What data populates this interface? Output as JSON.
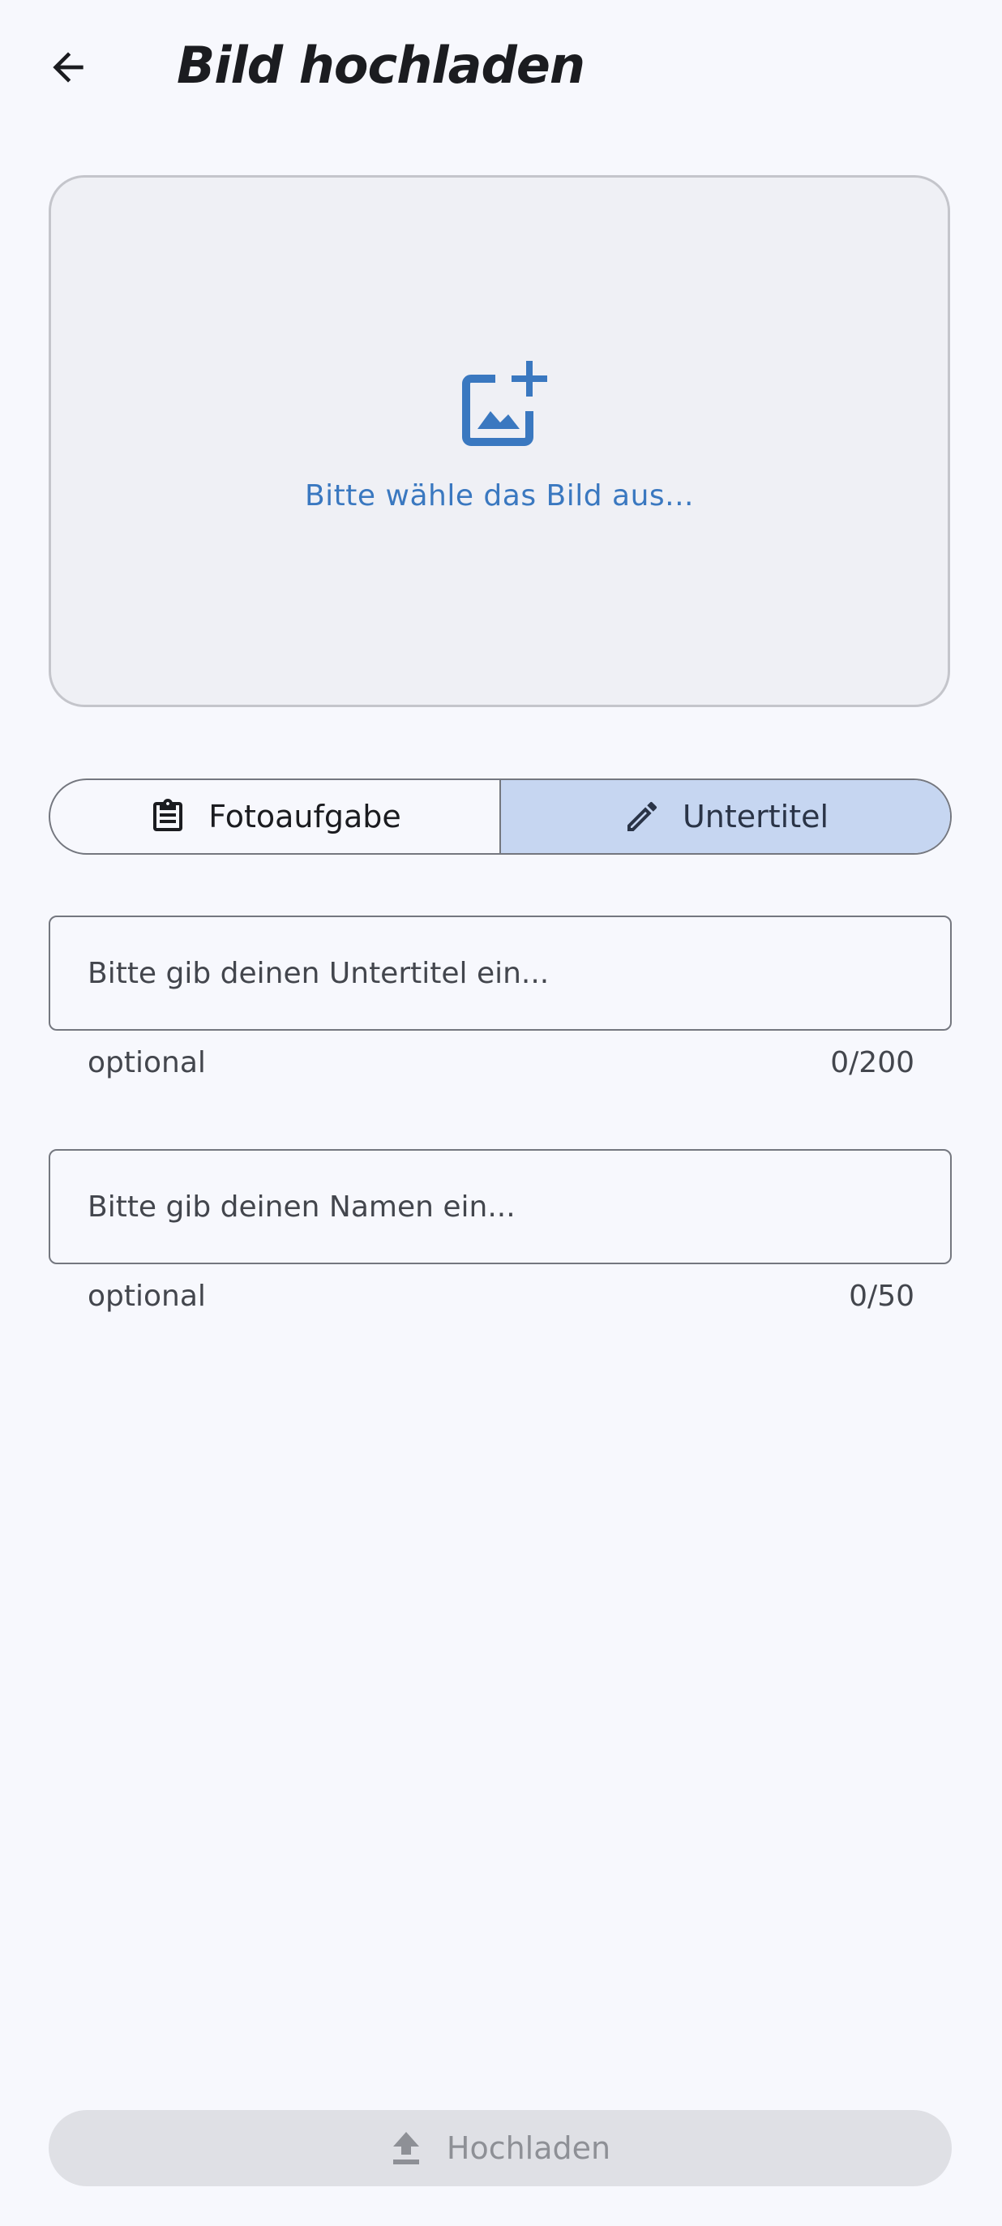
{
  "header": {
    "back_icon": "arrow-back-icon",
    "title": "Bild hochladen"
  },
  "image_picker": {
    "icon": "add-photo-icon",
    "prompt": "Bitte wähle das Bild aus...",
    "accent_color": "#3a78c0"
  },
  "segments": [
    {
      "label": "Fotoaufgabe",
      "icon": "clipboard-icon",
      "selected": false
    },
    {
      "label": "Untertitel",
      "icon": "pencil-icon",
      "selected": true
    }
  ],
  "caption_field": {
    "placeholder": "Bitte gib deinen Untertitel ein...",
    "value": "",
    "helper": "optional",
    "counter": "0/200"
  },
  "name_field": {
    "placeholder": "Bitte gib deinen Namen ein...",
    "value": "",
    "helper": "optional",
    "counter": "0/50"
  },
  "upload_button": {
    "icon": "upload-icon",
    "label": "Hochladen",
    "enabled": false
  }
}
